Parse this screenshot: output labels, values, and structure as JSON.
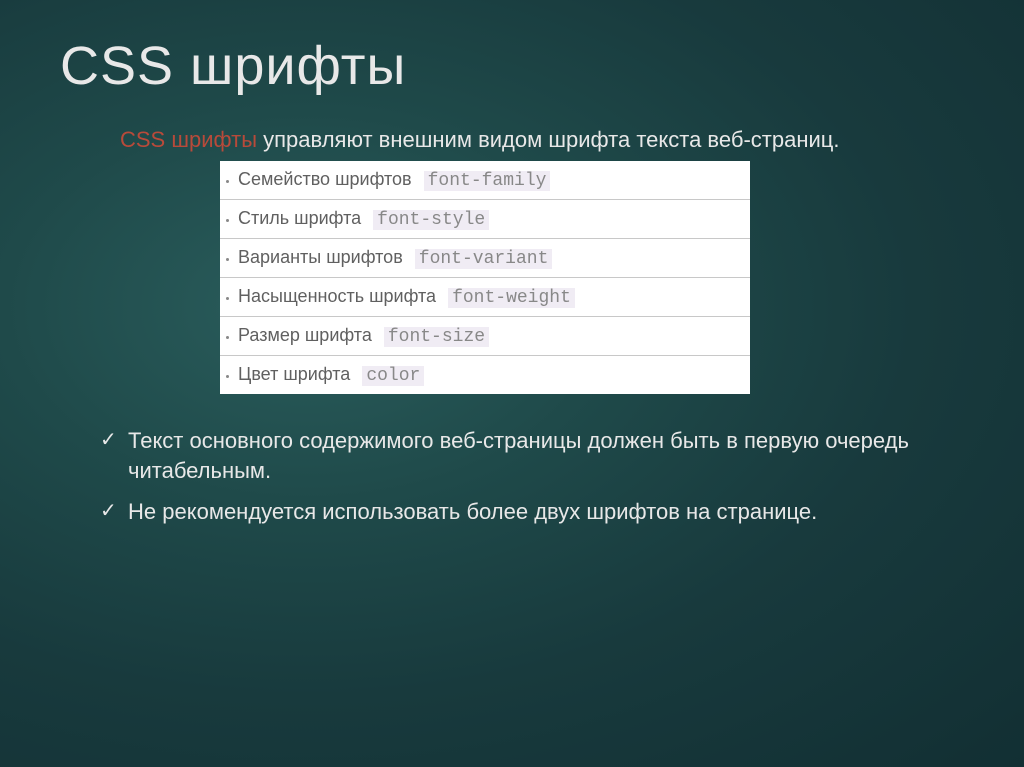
{
  "title": "CSS шрифты",
  "intro": {
    "emphasis": "CSS шрифты",
    "rest": " управляют внешним видом шрифта текста веб-страниц."
  },
  "rows": [
    {
      "label": "Семейство шрифтов",
      "code": "font-family"
    },
    {
      "label": "Стиль шрифта",
      "code": "font-style"
    },
    {
      "label": "Варианты шрифтов",
      "code": "font-variant"
    },
    {
      "label": "Насыщенность шрифта",
      "code": "font-weight"
    },
    {
      "label": "Размер шрифта",
      "code": "font-size"
    },
    {
      "label": "Цвет шрифта",
      "code": "color"
    }
  ],
  "bullets": [
    "Текст основного содержимого веб-страницы должен быть в первую очередь читабельным.",
    "Не рекомендуется использовать более двух шрифтов на странице."
  ]
}
